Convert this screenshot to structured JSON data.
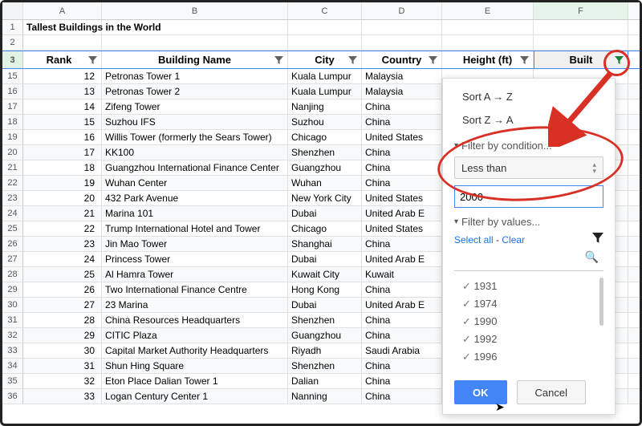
{
  "title": "Tallest Buildings in the World",
  "columns": {
    "A": "A",
    "B": "B",
    "C": "C",
    "D": "D",
    "E": "E",
    "F": "F"
  },
  "headers": {
    "rank": "Rank",
    "building": "Building Name",
    "city": "City",
    "country": "Country",
    "height": "Height (ft)",
    "built": "Built"
  },
  "rows": [
    {
      "rn": "15",
      "rank": "12",
      "b": "Petronas Tower 1",
      "c": "Kuala Lumpur",
      "d": "Malaysia"
    },
    {
      "rn": "16",
      "rank": "13",
      "b": "Petronas Tower 2",
      "c": "Kuala Lumpur",
      "d": "Malaysia"
    },
    {
      "rn": "17",
      "rank": "14",
      "b": "Zifeng Tower",
      "c": "Nanjing",
      "d": "China"
    },
    {
      "rn": "18",
      "rank": "15",
      "b": "Suzhou IFS",
      "c": "Suzhou",
      "d": "China"
    },
    {
      "rn": "19",
      "rank": "16",
      "b": "Willis Tower (formerly the Sears Tower)",
      "c": "Chicago",
      "d": "United States"
    },
    {
      "rn": "20",
      "rank": "17",
      "b": "KK100",
      "c": "Shenzhen",
      "d": "China"
    },
    {
      "rn": "21",
      "rank": "18",
      "b": "Guangzhou International Finance Center",
      "c": "Guangzhou",
      "d": "China"
    },
    {
      "rn": "22",
      "rank": "19",
      "b": "Wuhan Center",
      "c": "Wuhan",
      "d": "China"
    },
    {
      "rn": "23",
      "rank": "20",
      "b": "432 Park Avenue",
      "c": "New York City",
      "d": "United States"
    },
    {
      "rn": "24",
      "rank": "21",
      "b": "Marina 101",
      "c": "Dubai",
      "d": "United Arab E"
    },
    {
      "rn": "25",
      "rank": "22",
      "b": "Trump International Hotel and Tower",
      "c": "Chicago",
      "d": "United States"
    },
    {
      "rn": "26",
      "rank": "23",
      "b": "Jin Mao Tower",
      "c": "Shanghai",
      "d": "China"
    },
    {
      "rn": "27",
      "rank": "24",
      "b": "Princess Tower",
      "c": "Dubai",
      "d": "United Arab E"
    },
    {
      "rn": "28",
      "rank": "25",
      "b": "Al Hamra Tower",
      "c": "Kuwait City",
      "d": "Kuwait"
    },
    {
      "rn": "29",
      "rank": "26",
      "b": "Two International Finance Centre",
      "c": "Hong Kong",
      "d": "China"
    },
    {
      "rn": "30",
      "rank": "27",
      "b": "23 Marina",
      "c": "Dubai",
      "d": "United Arab E"
    },
    {
      "rn": "31",
      "rank": "28",
      "b": "China Resources Headquarters",
      "c": "Shenzhen",
      "d": "China"
    },
    {
      "rn": "32",
      "rank": "29",
      "b": "CITIC Plaza",
      "c": "Guangzhou",
      "d": "China"
    },
    {
      "rn": "33",
      "rank": "30",
      "b": "Capital Market Authority Headquarters",
      "c": "Riyadh",
      "d": "Saudi Arabia"
    },
    {
      "rn": "34",
      "rank": "31",
      "b": "Shun Hing Square",
      "c": "Shenzhen",
      "d": "China"
    },
    {
      "rn": "35",
      "rank": "32",
      "b": "Eton Place Dalian Tower 1",
      "c": "Dalian",
      "d": "China"
    },
    {
      "rn": "36",
      "rank": "33",
      "b": "Logan Century Center 1",
      "c": "Nanning",
      "d": "China"
    }
  ],
  "filter": {
    "sort_az": "Sort A → Z",
    "sort_za": "Sort Z → A",
    "by_cond": "Filter by condition...",
    "condition": "Less than",
    "value": "2000",
    "by_vals": "Filter by values...",
    "select_all": "Select all",
    "dash": " - ",
    "clear": "Clear",
    "values": [
      "1931",
      "1974",
      "1990",
      "1992",
      "1996"
    ],
    "ok": "OK",
    "cancel": "Cancel"
  },
  "first_rows_nums": {
    "r1": "1",
    "r2": "2",
    "r3": "3"
  }
}
